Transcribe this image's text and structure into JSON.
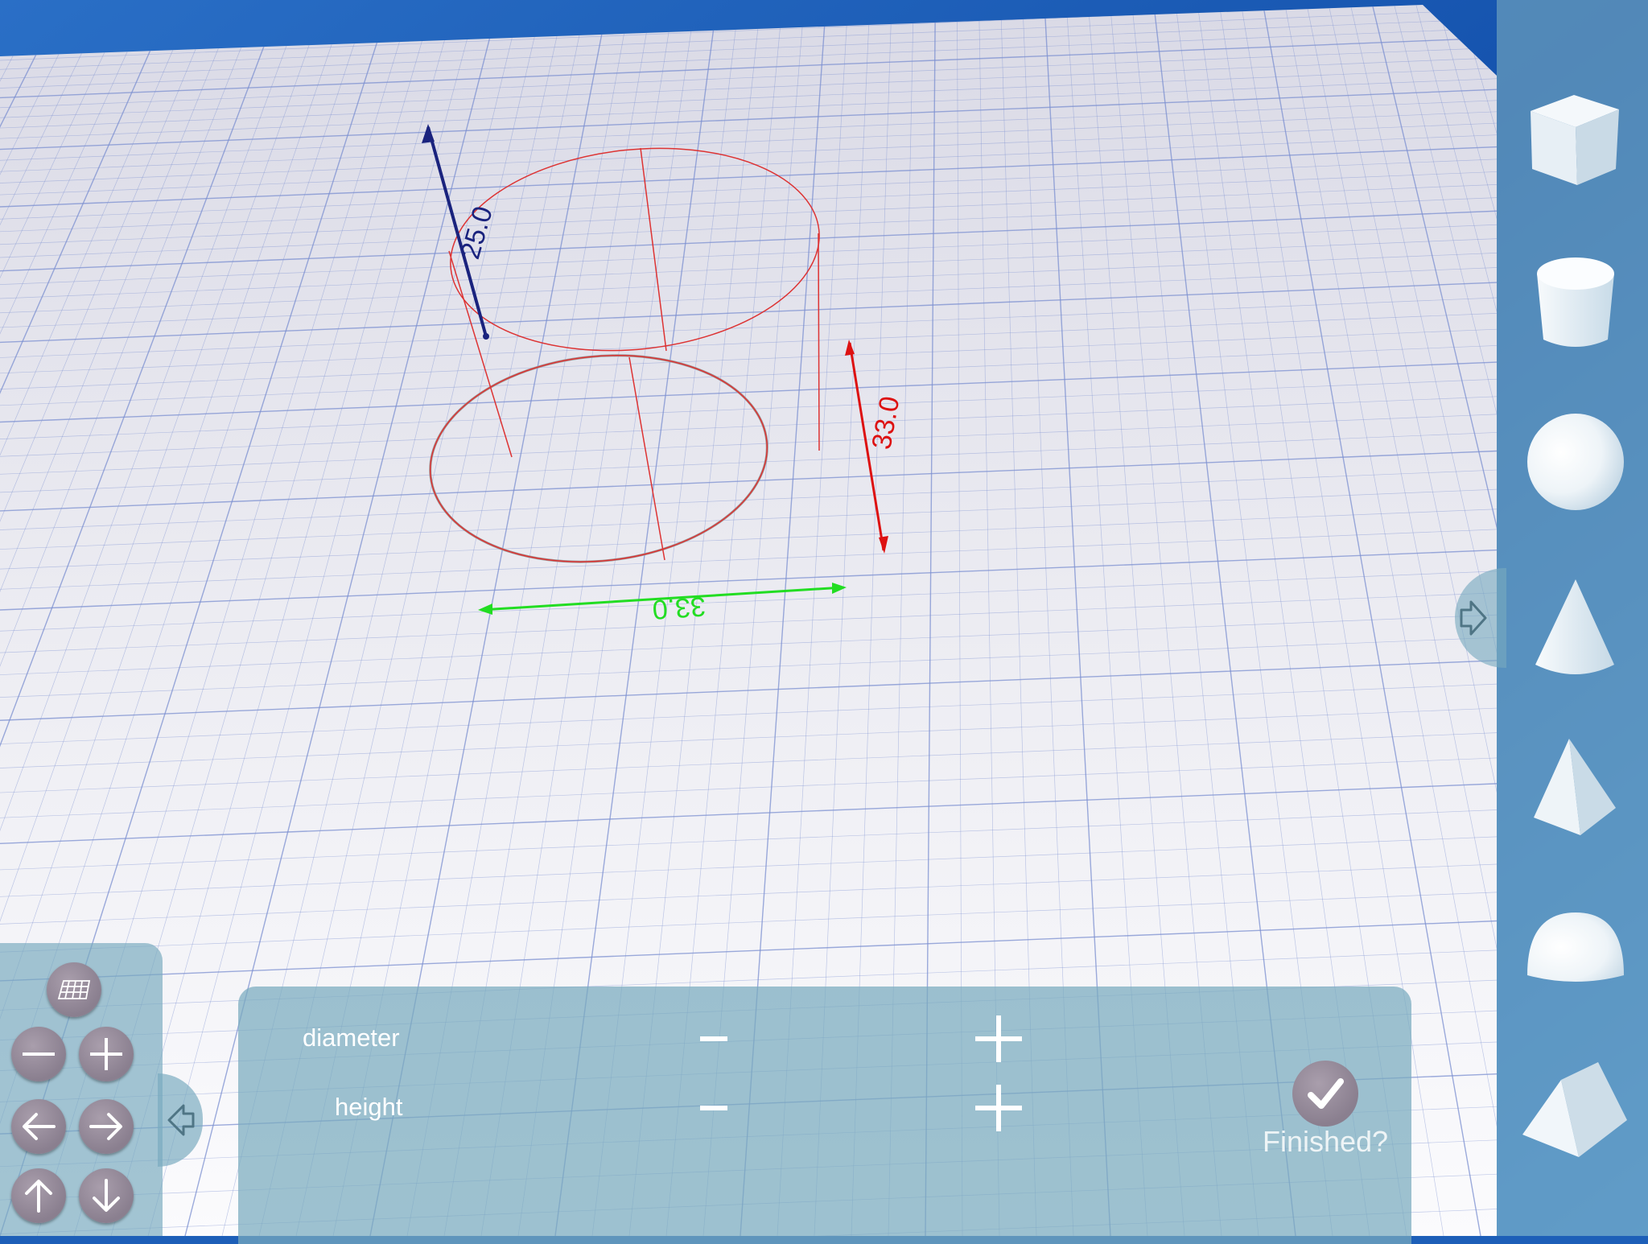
{
  "viewport": {
    "dimensions": {
      "height_value": "25.0",
      "width_value": "33.0",
      "depth_value": "33.0"
    }
  },
  "shape_palette": {
    "items": [
      {
        "name": "cube",
        "icon": "cube-icon"
      },
      {
        "name": "cylinder",
        "icon": "cylinder-icon"
      },
      {
        "name": "sphere",
        "icon": "sphere-icon"
      },
      {
        "name": "cone",
        "icon": "cone-icon"
      },
      {
        "name": "pyramid",
        "icon": "pyramid-icon"
      },
      {
        "name": "hemisphere",
        "icon": "hemisphere-icon"
      },
      {
        "name": "prism",
        "icon": "prism-icon"
      }
    ],
    "toggle_icon": "arrow-right-icon"
  },
  "nav_controls": {
    "grid_icon": "grid-icon",
    "zoom_out_icon": "minus-icon",
    "zoom_in_icon": "plus-icon",
    "left_icon": "arrow-left-icon",
    "right_icon": "arrow-right-icon",
    "up_icon": "arrow-up-icon",
    "down_icon": "arrow-down-icon",
    "toggle_icon": "arrow-left-icon"
  },
  "params": {
    "diameter_label": "diameter",
    "height_label": "height",
    "minus_icon": "minus-icon",
    "plus_icon": "plus-icon"
  },
  "finish": {
    "label": "Finished?",
    "icon": "checkmark-icon"
  },
  "colors": {
    "sky": "#1d5fb8",
    "panel": "#78aabe",
    "button": "#8a7f8f",
    "height_axis": "#1a237e",
    "width_axis": "#22dd22",
    "depth_axis": "#dd1111",
    "outline": "#dd3333"
  }
}
